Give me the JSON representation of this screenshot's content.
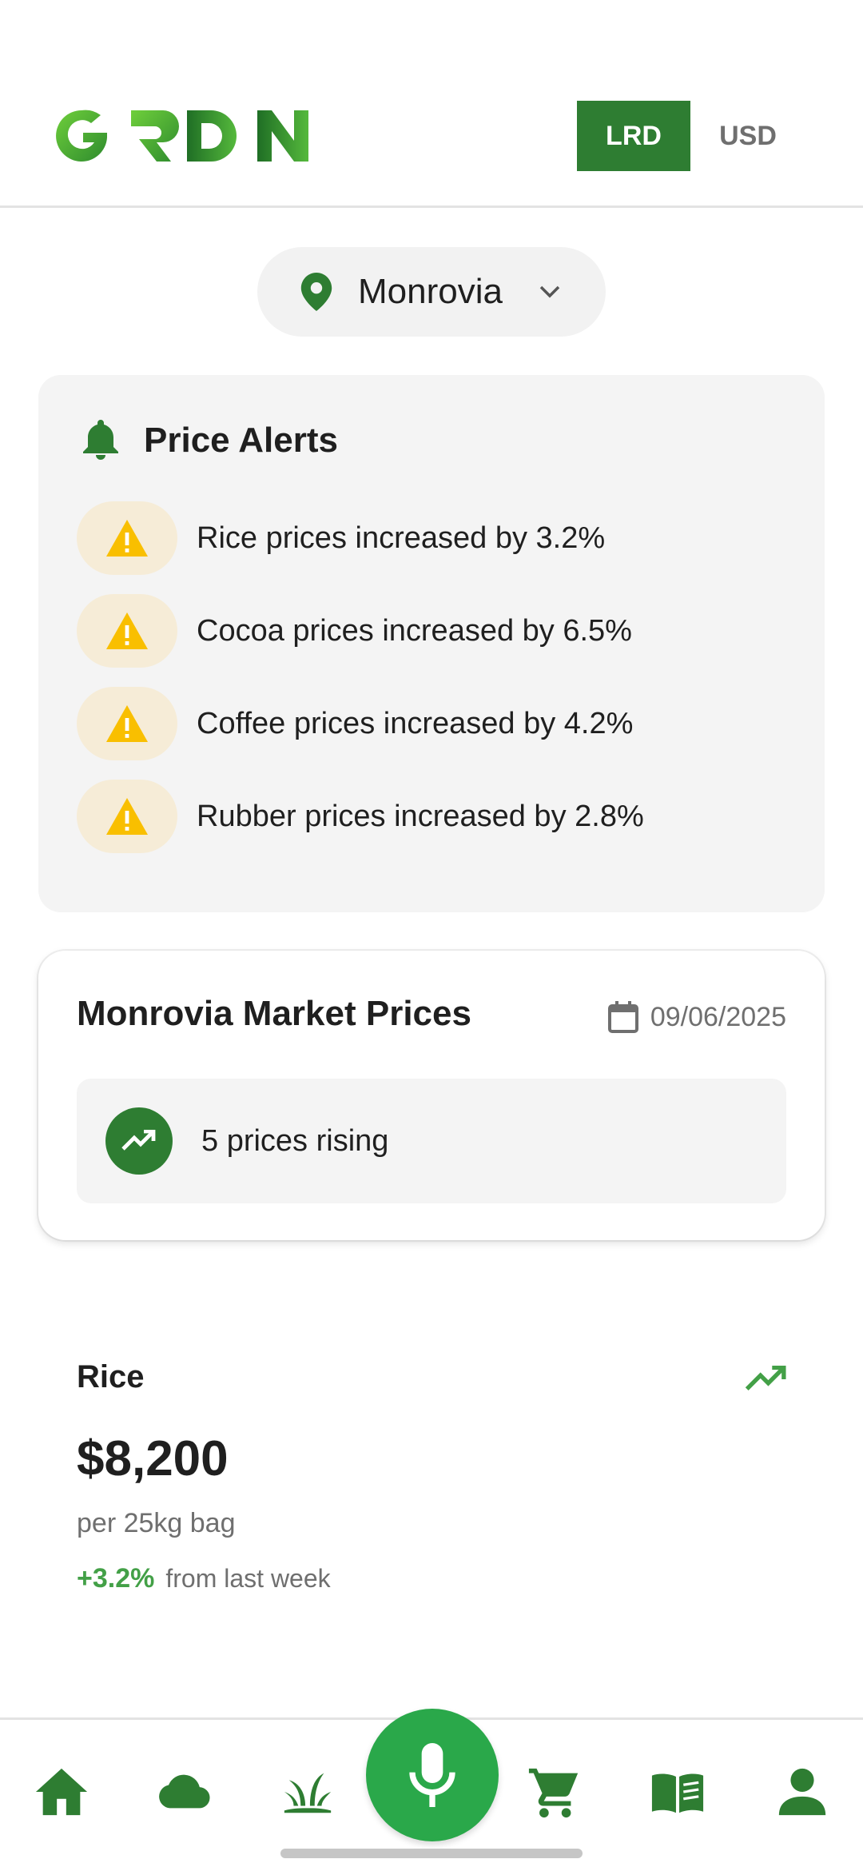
{
  "header": {
    "logo_text": "GRDN",
    "currency_options": [
      "LRD",
      "USD"
    ],
    "currency_selected": "LRD"
  },
  "location": {
    "name": "Monrovia"
  },
  "alerts": {
    "title": "Price Alerts",
    "items": [
      "Rice prices increased by 3.2%",
      "Cocoa prices increased by 6.5%",
      "Coffee prices increased by 4.2%",
      "Rubber prices increased by 2.8%"
    ]
  },
  "market": {
    "title": "Monrovia Market Prices",
    "date": "09/06/2025",
    "rising_text": "5 prices rising"
  },
  "product": {
    "name": "Rice",
    "price": "$8,200",
    "unit": "per 25kg bag",
    "change": "+3.2%",
    "change_suffix": "from last week"
  },
  "nav": {
    "items": [
      "home-icon",
      "cloud-icon",
      "sprout-icon",
      "microphone-icon",
      "cart-icon",
      "book-icon",
      "person-icon"
    ]
  },
  "colors": {
    "brand_green": "#2e7d32",
    "mic_green": "#2aa84a",
    "alert_yellow": "#f9bf00",
    "positive_green": "#43a047"
  }
}
